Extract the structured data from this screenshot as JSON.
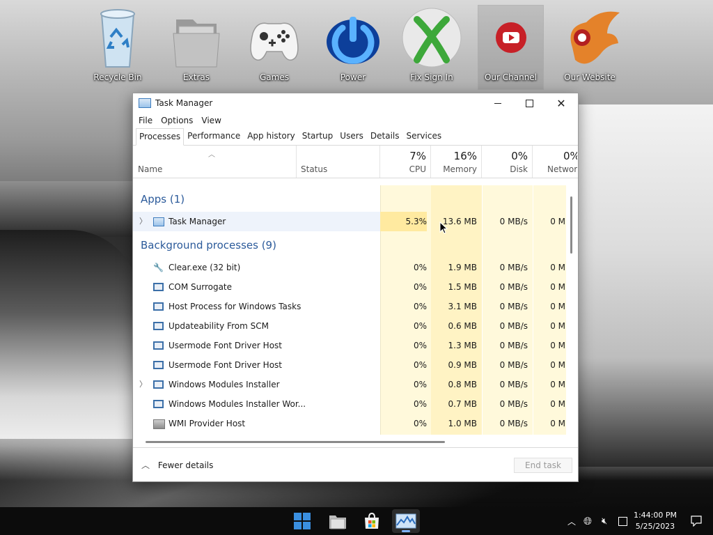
{
  "desktop": {
    "icons": [
      {
        "label": "Recycle Bin",
        "icon": "recycle-bin-icon"
      },
      {
        "label": "Extras",
        "icon": "folder-icon"
      },
      {
        "label": "Games",
        "icon": "gamepad-icon"
      },
      {
        "label": "Power",
        "icon": "power-icon"
      },
      {
        "label": "Fix Sign In",
        "icon": "xbox-icon"
      },
      {
        "label": "Our Channel",
        "icon": "youtube-icon"
      },
      {
        "label": "Our Website",
        "icon": "phoenix-icon"
      }
    ]
  },
  "window": {
    "title": "Task Manager",
    "menu": [
      "File",
      "Options",
      "View"
    ],
    "tabs": [
      "Processes",
      "Performance",
      "App history",
      "Startup",
      "Users",
      "Details",
      "Services"
    ],
    "active_tab": "Processes",
    "columns": {
      "name": "Name",
      "status": "Status",
      "cpu": {
        "pct": "7%",
        "label": "CPU"
      },
      "memory": {
        "pct": "16%",
        "label": "Memory"
      },
      "disk": {
        "pct": "0%",
        "label": "Disk"
      },
      "network": {
        "pct": "0%",
        "label": "Network"
      }
    },
    "groups": {
      "apps": "Apps (1)",
      "background": "Background processes (9)"
    },
    "apps": [
      {
        "name": "Task Manager",
        "cpu": "5.3%",
        "memory": "13.6 MB",
        "disk": "0 MB/s",
        "network": "0 M",
        "expandable": true,
        "icon": "task-manager-icon"
      }
    ],
    "background": [
      {
        "name": "Clear.exe (32 bit)",
        "cpu": "0%",
        "memory": "1.9 MB",
        "disk": "0 MB/s",
        "network": "0 M",
        "expandable": false,
        "icon": "wrench-icon"
      },
      {
        "name": "COM Surrogate",
        "cpu": "0%",
        "memory": "1.5 MB",
        "disk": "0 MB/s",
        "network": "0 M",
        "expandable": false,
        "icon": "service-window-icon"
      },
      {
        "name": "Host Process for Windows Tasks",
        "cpu": "0%",
        "memory": "3.1 MB",
        "disk": "0 MB/s",
        "network": "0 M",
        "expandable": false,
        "icon": "service-window-icon"
      },
      {
        "name": "Updateability From SCM",
        "cpu": "0%",
        "memory": "0.6 MB",
        "disk": "0 MB/s",
        "network": "0 M",
        "expandable": false,
        "icon": "service-window-icon"
      },
      {
        "name": "Usermode Font Driver Host",
        "cpu": "0%",
        "memory": "1.3 MB",
        "disk": "0 MB/s",
        "network": "0 M",
        "expandable": false,
        "icon": "service-window-icon"
      },
      {
        "name": "Usermode Font Driver Host",
        "cpu": "0%",
        "memory": "0.9 MB",
        "disk": "0 MB/s",
        "network": "0 M",
        "expandable": false,
        "icon": "service-window-icon"
      },
      {
        "name": "Windows Modules Installer",
        "cpu": "0%",
        "memory": "0.8 MB",
        "disk": "0 MB/s",
        "network": "0 M",
        "expandable": true,
        "icon": "service-window-icon"
      },
      {
        "name": "Windows Modules Installer Wor...",
        "cpu": "0%",
        "memory": "0.7 MB",
        "disk": "0 MB/s",
        "network": "0 M",
        "expandable": false,
        "icon": "service-window-icon"
      },
      {
        "name": "WMI Provider Host",
        "cpu": "0%",
        "memory": "1.0 MB",
        "disk": "0 MB/s",
        "network": "0 M",
        "expandable": false,
        "icon": "wmi-icon"
      }
    ],
    "footer": {
      "fewer_details": "Fewer details",
      "end_task": "End task"
    }
  },
  "taskbar": {
    "apps": [
      "start-icon",
      "file-explorer-icon",
      "microsoft-store-icon",
      "task-manager-icon"
    ],
    "tray": [
      "chevron-up-icon",
      "network-icon",
      "volume-muted-icon",
      "input-icon"
    ],
    "time": "1:44:00 PM",
    "date": "5/25/2023",
    "notification_icon": "notification-icon"
  }
}
